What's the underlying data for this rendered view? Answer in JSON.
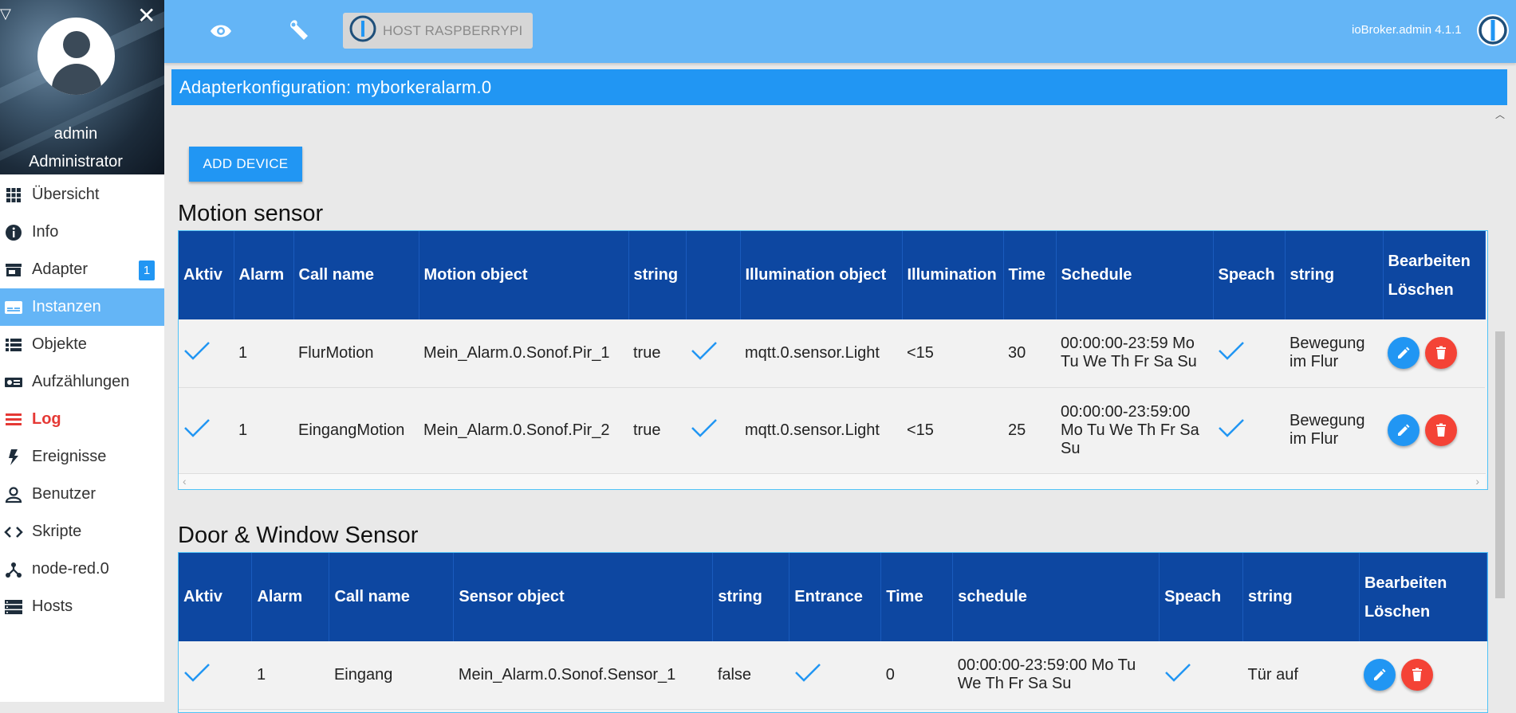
{
  "sidebar": {
    "user_name": "admin",
    "user_role": "Administrator",
    "items": [
      {
        "label": "Übersicht",
        "icon": "grid-icon"
      },
      {
        "label": "Info",
        "icon": "info-icon"
      },
      {
        "label": "Adapter",
        "icon": "store-icon",
        "badge": "1"
      },
      {
        "label": "Instanzen",
        "icon": "instances-icon",
        "active": true
      },
      {
        "label": "Objekte",
        "icon": "list-icon"
      },
      {
        "label": "Aufzählungen",
        "icon": "enum-icon"
      },
      {
        "label": "Log",
        "icon": "log-icon"
      },
      {
        "label": "Ereignisse",
        "icon": "bolt-icon"
      },
      {
        "label": "Benutzer",
        "icon": "user-icon"
      },
      {
        "label": "Skripte",
        "icon": "code-icon"
      },
      {
        "label": "node-red.0",
        "icon": "nodes-icon"
      },
      {
        "label": "Hosts",
        "icon": "hosts-icon"
      }
    ]
  },
  "topbar": {
    "host_label": "HOST RASPBERRYPI",
    "version": "ioBroker.admin 4.1.1"
  },
  "page": {
    "title": "Adapterkonfiguration: myborkeralarm.0",
    "add_device_label": "ADD DEVICE"
  },
  "motion": {
    "title": "Motion sensor",
    "headers": [
      "Aktiv",
      "Alarm",
      "Call name",
      "Motion object",
      "string",
      "",
      "Illumination object",
      "Illumination",
      "Time",
      "Schedule",
      "Speach",
      "string",
      "Bearbeiten Löschen"
    ],
    "rows": [
      {
        "aktiv": true,
        "alarm": "1",
        "call_name": "FlurMotion",
        "motion_object": "Mein_Alarm.0.Sonof.Pir_1",
        "string": "true",
        "check2": true,
        "illumination_object": "mqtt.0.sensor.Light",
        "illumination": "<15",
        "time": "30",
        "schedule": "00:00:00-23:59 Mo Tu We Th Fr Sa Su",
        "speach": true,
        "string2": "Bewegung im Flur"
      },
      {
        "aktiv": true,
        "alarm": "1",
        "call_name": "EingangMotion",
        "motion_object": "Mein_Alarm.0.Sonof.Pir_2",
        "string": "true",
        "check2": true,
        "illumination_object": "mqtt.0.sensor.Light",
        "illumination": "<15",
        "time": "25",
        "schedule": "00:00:00-23:59:00 Mo Tu We Th Fr Sa Su",
        "speach": true,
        "string2": "Bewegung im Flur"
      }
    ]
  },
  "door": {
    "title": "Door & Window Sensor",
    "headers": [
      "Aktiv",
      "Alarm",
      "Call name",
      "Sensor object",
      "string",
      "Entrance",
      "Time",
      "schedule",
      "Speach",
      "string",
      "Bearbeiten Löschen"
    ],
    "rows": [
      {
        "aktiv": true,
        "alarm": "1",
        "call_name": "Eingang",
        "sensor_object": "Mein_Alarm.0.Sonof.Sensor_1",
        "string": "false",
        "entrance": true,
        "time": "0",
        "schedule": "00:00:00-23:59:00 Mo Tu We Th Fr Sa Su",
        "speach": true,
        "string2": "Tür auf"
      }
    ]
  },
  "colors": {
    "topbar": "#64b5f6",
    "accent": "#2196f3",
    "table_header": "#0d47a1",
    "delete": "#f44336",
    "log": "#e53935"
  }
}
